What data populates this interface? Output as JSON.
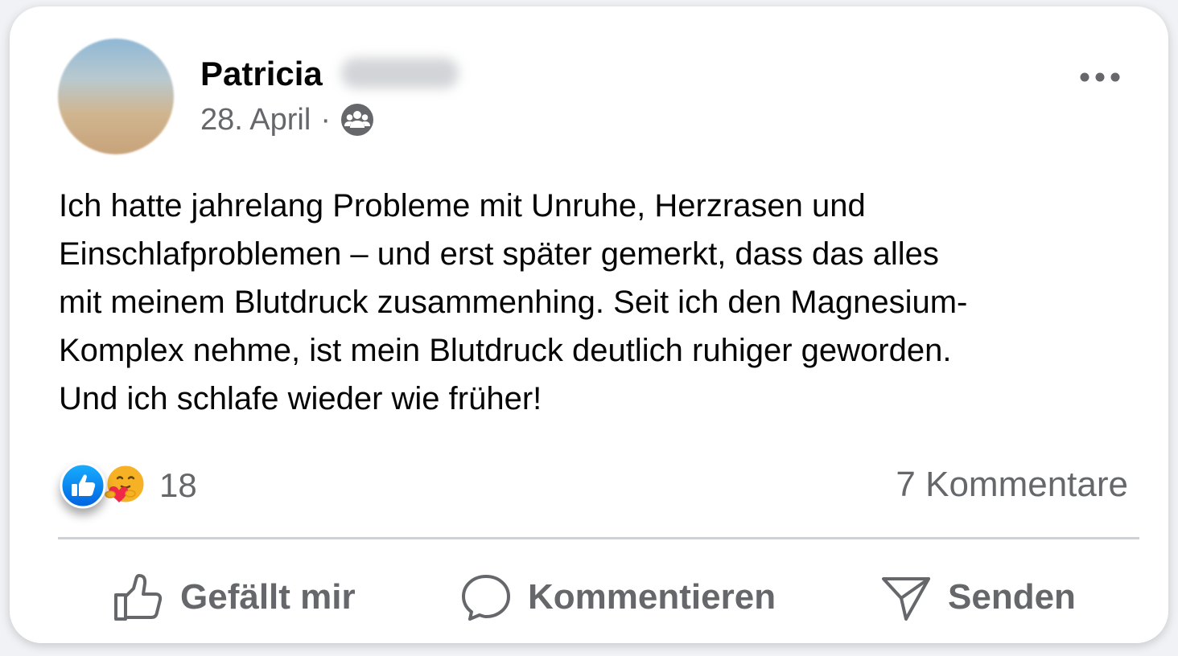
{
  "post": {
    "author_first_name": "Patricia",
    "date": "28. April",
    "separator": "·",
    "audience_icon": "group-icon",
    "more_icon": "more-icon",
    "text_lines": [
      "Ich hatte jahrelang Probleme mit Unruhe, Herzrasen und",
      "Einschlafproblemen – und erst später gemerkt, dass das alles",
      "mit meinem Blutdruck zusammenhing. Seit ich den Magnesium-",
      "Komplex nehme, ist mein Blutdruck deutlich ruhiger geworden.",
      "Und ich schlafe wieder wie früher!"
    ]
  },
  "reactions": {
    "icons": [
      "like-reaction-icon",
      "care-reaction-icon"
    ],
    "count": "18",
    "comments": "7 Kommentare"
  },
  "actions": {
    "like": "Gefällt mir",
    "comment": "Kommentieren",
    "send": "Senden"
  },
  "colors": {
    "text": "#050505",
    "secondary_text": "#65676b",
    "like_blue": "#1877f2",
    "care_red": "#f02849",
    "care_yellow": "#f7b125",
    "divider": "#ced0d4"
  }
}
